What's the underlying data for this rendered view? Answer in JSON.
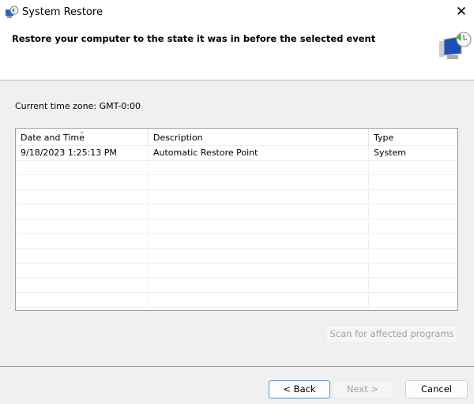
{
  "window": {
    "title": "System Restore",
    "close_icon": "close-icon"
  },
  "heading": "Restore your computer to the state it was in before the selected event",
  "timezone": "Current time zone: GMT-0:00",
  "table": {
    "columns": [
      "Date and Time",
      "Description",
      "Type"
    ],
    "rows": [
      {
        "date": "9/18/2023 1:25:13 PM",
        "description": "Automatic Restore Point",
        "type": "System"
      }
    ]
  },
  "buttons": {
    "scan": "Scan for affected programs",
    "back": "< Back",
    "next": "Next >",
    "cancel": "Cancel"
  }
}
